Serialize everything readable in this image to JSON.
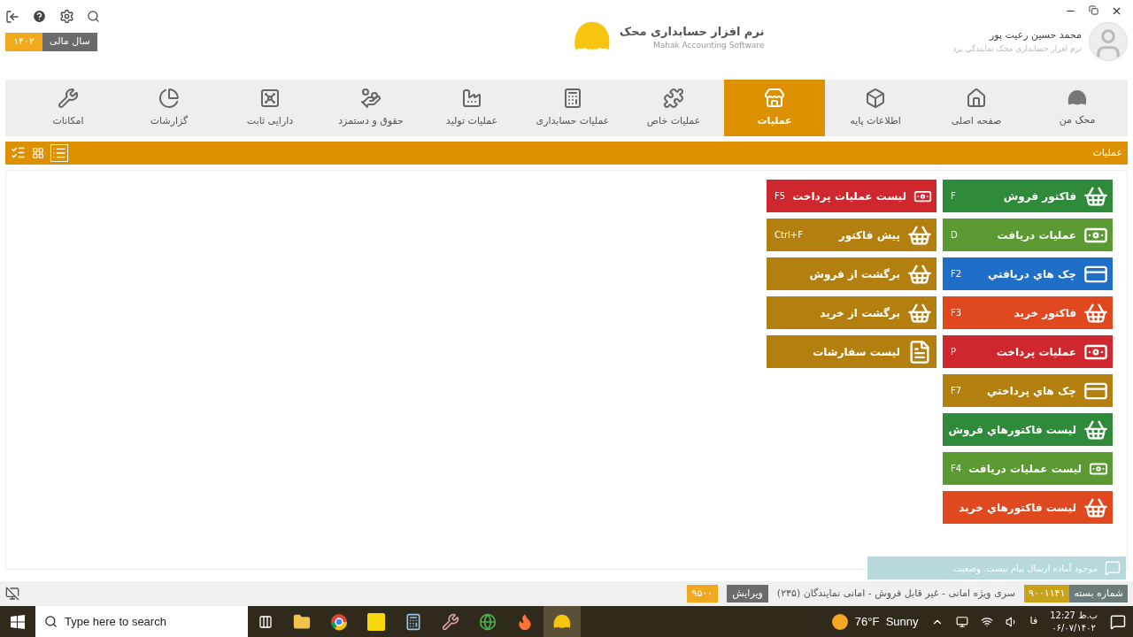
{
  "header": {
    "fiscal_year_label": "سال مالی",
    "fiscal_year": "۱۴۰۲",
    "app_title": "نرم افزار حسابداری محک",
    "app_subtitle": "Mahak Accounting Software",
    "user_name": "محمد حسین رعیت پور",
    "user_org": "نرم افزار حسابداري محک نمايندگي يزد"
  },
  "nav": [
    {
      "label": "محک من",
      "kind": "blob",
      "selected": false
    },
    {
      "label": "صفحه اصلی",
      "kind": "home",
      "selected": false
    },
    {
      "label": "اطلاعات پایه",
      "kind": "box",
      "selected": false
    },
    {
      "label": "عملیات",
      "kind": "register",
      "selected": true
    },
    {
      "label": "عملیات خاص",
      "kind": "puzzle",
      "selected": false
    },
    {
      "label": "عملیات حسابداری",
      "kind": "calculator",
      "selected": false
    },
    {
      "label": "عملیات تولید",
      "kind": "factory",
      "selected": false
    },
    {
      "label": "حقوق و دستمزد",
      "kind": "hand",
      "selected": false
    },
    {
      "label": "دارایی ثابت",
      "kind": "safe",
      "selected": false
    },
    {
      "label": "گزارشات",
      "kind": "chart",
      "selected": false
    },
    {
      "label": "امکانات",
      "kind": "tools",
      "selected": false
    }
  ],
  "section_title": "عملیات",
  "view": {
    "list_selected": true
  },
  "tile_columns": [
    [
      {
        "label": "فاکتور فروش",
        "key": "F",
        "kind": "basket",
        "color": "#2f8a3a"
      },
      {
        "label": "عملیات دریافت",
        "key": "D",
        "kind": "money",
        "color": "#5b9a33"
      },
      {
        "label": "چک هاي دريافتي",
        "key": "F2",
        "kind": "card",
        "color": "#1f6ec8"
      },
      {
        "label": "فاکتور خرید",
        "key": "F3",
        "kind": "basket",
        "color": "#e0481f"
      },
      {
        "label": "عملیات پرداخت",
        "key": "P",
        "kind": "money",
        "color": "#cf272e"
      },
      {
        "label": "چک هاي پرداختي",
        "key": "F7",
        "kind": "card",
        "color": "#b3800f"
      },
      {
        "label": "لیست فاکتورهاي فروش",
        "kind": "basket",
        "color": "#2f8a3a"
      },
      {
        "label": "لیست عملیات دریافت",
        "key": "F4",
        "kind": "money",
        "color": "#5b9a33"
      },
      {
        "label": "لیست فاکتورهاي خرید",
        "kind": "basket",
        "color": "#e0481f"
      }
    ],
    [
      {
        "label": "لیست عملیات پرداخت",
        "key": "F5",
        "kind": "money",
        "color": "#cf272e"
      },
      {
        "label": "پیش فاکتور",
        "key": "Ctrl+F",
        "kind": "basket",
        "color": "#b3800f"
      },
      {
        "label": "برگشت از فروش",
        "kind": "basket",
        "color": "#b3800f"
      },
      {
        "label": "برگشت از خرید",
        "kind": "basket",
        "color": "#b3800f"
      },
      {
        "label": "لیست سفارشات",
        "kind": "doc",
        "color": "#b3800f"
      }
    ]
  ],
  "status_bar": {
    "package_label": "شماره بسته",
    "package_number": "۹۰۰۱۱۴۱",
    "series": "سری ویژه امانی - غیر قابل فروش - امانی نمایندگان (۲۳۵)",
    "edition_label": "ویرایش",
    "edition": "۹۵۰۰"
  },
  "toast": {
    "message": "موجود آماده ارسال پیام نیست. وضعیت"
  },
  "taskbar": {
    "search_placeholder": "Type here to search",
    "weather": "76°F  Sunny",
    "lang": "فا",
    "time": "12:27 ب.ظ",
    "date": "۰۶/۰۷/۱۴۰۲"
  }
}
